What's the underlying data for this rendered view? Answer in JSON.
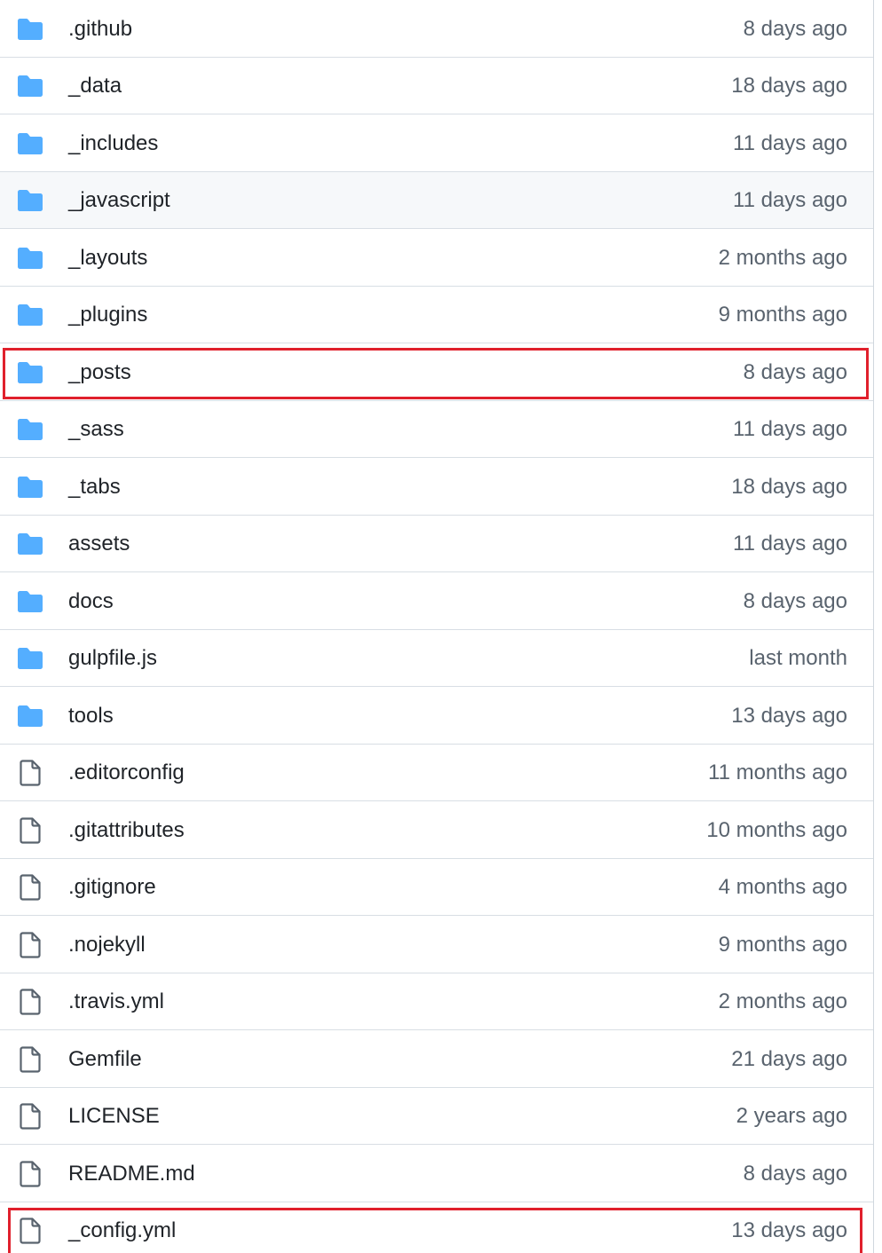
{
  "entries": [
    {
      "type": "folder",
      "icon": "folder-icon",
      "name": ".github",
      "age": "8 days ago"
    },
    {
      "type": "folder",
      "icon": "folder-icon",
      "name": "_data",
      "age": "18 days ago"
    },
    {
      "type": "folder",
      "icon": "folder-icon",
      "name": "_includes",
      "age": "11 days ago"
    },
    {
      "type": "folder",
      "icon": "folder-icon",
      "name": "_javascript",
      "age": "11 days ago",
      "hovered": true
    },
    {
      "type": "folder",
      "icon": "folder-icon",
      "name": "_layouts",
      "age": "2 months ago"
    },
    {
      "type": "folder",
      "icon": "folder-icon",
      "name": "_plugins",
      "age": "9 months ago"
    },
    {
      "type": "folder",
      "icon": "folder-icon",
      "name": "_posts",
      "age": "8 days ago",
      "highlighted": true
    },
    {
      "type": "folder",
      "icon": "folder-icon",
      "name": "_sass",
      "age": "11 days ago"
    },
    {
      "type": "folder",
      "icon": "folder-icon",
      "name": "_tabs",
      "age": "18 days ago"
    },
    {
      "type": "folder",
      "icon": "folder-icon",
      "name": "assets",
      "age": "11 days ago"
    },
    {
      "type": "folder",
      "icon": "folder-icon",
      "name": "docs",
      "age": "8 days ago"
    },
    {
      "type": "folder",
      "icon": "folder-icon",
      "name": "gulpfile.js",
      "age": "last month"
    },
    {
      "type": "folder",
      "icon": "folder-icon",
      "name": "tools",
      "age": "13 days ago"
    },
    {
      "type": "file",
      "icon": "file-icon",
      "name": ".editorconfig",
      "age": "11 months ago"
    },
    {
      "type": "file",
      "icon": "file-icon",
      "name": ".gitattributes",
      "age": "10 months ago"
    },
    {
      "type": "file",
      "icon": "file-icon",
      "name": ".gitignore",
      "age": "4 months ago"
    },
    {
      "type": "file",
      "icon": "file-icon",
      "name": ".nojekyll",
      "age": "9 months ago"
    },
    {
      "type": "file",
      "icon": "file-icon",
      "name": ".travis.yml",
      "age": "2 months ago"
    },
    {
      "type": "file",
      "icon": "file-icon",
      "name": "Gemfile",
      "age": "21 days ago"
    },
    {
      "type": "file",
      "icon": "file-icon",
      "name": "LICENSE",
      "age": "2 years ago"
    },
    {
      "type": "file",
      "icon": "file-icon",
      "name": "README.md",
      "age": "8 days ago"
    },
    {
      "type": "file",
      "icon": "file-icon",
      "name": "_config.yml",
      "age": "13 days ago",
      "highlighted": true
    }
  ],
  "colors": {
    "folder": "#54aeff",
    "file": "#59636e",
    "name_text": "#1f2328",
    "age_text": "#59636e",
    "highlight": "#e0202c",
    "hover_bg": "#f6f8fa"
  }
}
